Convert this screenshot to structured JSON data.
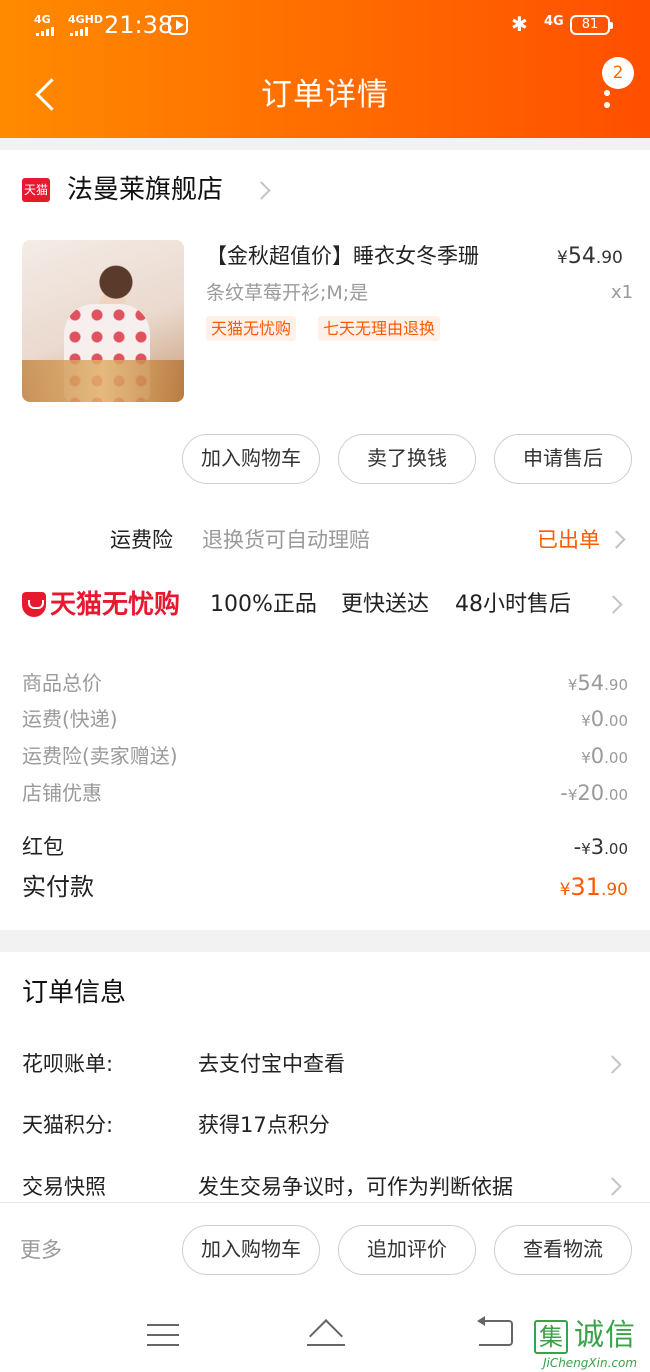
{
  "status_bar": {
    "signal_1": "4G",
    "signal_2": "4GHD",
    "time": "21:38",
    "network": "4G",
    "battery": "81"
  },
  "header": {
    "title": "订单详情",
    "notification_count": "2"
  },
  "shop": {
    "logo_text": "天猫",
    "name": "法曼莱旗舰店"
  },
  "product": {
    "title": "【金秋超值价】睡衣女冬季珊",
    "spec": "条纹草莓开衫;M;是",
    "price_symbol": "¥",
    "price_int": "54",
    "price_dec": ".90",
    "quantity": "x1",
    "tags": [
      "天猫无忧购",
      "七天无理由退换"
    ]
  },
  "item_actions": [
    "加入购物车",
    "卖了换钱",
    "申请售后"
  ],
  "shipping_insurance": {
    "label": "运费险",
    "description": "退换货可自动理赔",
    "status": "已出单"
  },
  "assurance": {
    "brand": "天猫无忧购",
    "features": [
      "100%正品",
      "更快送达",
      "48小时售后"
    ]
  },
  "fees": [
    {
      "label": "商品总价",
      "sign": "",
      "symbol": "¥",
      "int": "54",
      "dec": ".90"
    },
    {
      "label": "运费(快递)",
      "sign": "",
      "symbol": "¥",
      "int": "0",
      "dec": ".00"
    },
    {
      "label": "运费险(卖家赠送)",
      "sign": "",
      "symbol": "¥",
      "int": "0",
      "dec": ".00"
    },
    {
      "label": "店铺优惠",
      "sign": "-",
      "symbol": "¥",
      "int": "20",
      "dec": ".00"
    }
  ],
  "red_packet": {
    "label": "红包",
    "sign": "-",
    "symbol": "¥",
    "int": "3",
    "dec": ".00"
  },
  "paid": {
    "label": "实付款",
    "symbol": "¥",
    "int": "31",
    "dec": ".90"
  },
  "order_info": {
    "title": "订单信息",
    "rows": [
      {
        "label": "花呗账单:",
        "value": "去支付宝中查看"
      },
      {
        "label": "天猫积分:",
        "value": "获得17点积分"
      },
      {
        "label": "交易快照",
        "value": "发生交易争议时，可作为判断依据"
      }
    ]
  },
  "bottom_bar": {
    "more": "更多",
    "buttons": [
      "加入购物车",
      "追加评价",
      "查看物流"
    ]
  },
  "watermark": {
    "logo_char": "集",
    "chars": "诚信",
    "url": "JiChengXin.com"
  },
  "colors": {
    "header_start": "#ff8a00",
    "header_end": "#ff4f00",
    "accent": "#ff5a00",
    "tmall_red": "#e8182f"
  }
}
